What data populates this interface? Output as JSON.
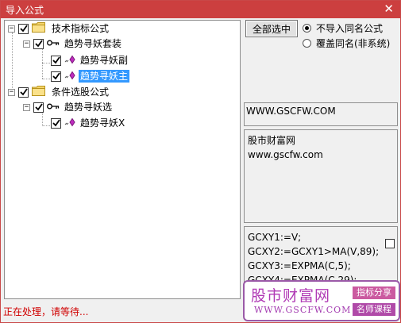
{
  "window": {
    "title": "导入公式",
    "close_glyph": "✕"
  },
  "tree": {
    "nodes": [
      {
        "label": "技术指标公式",
        "expander": "−",
        "icon": "folder-icon"
      },
      {
        "label": "趋势寻妖套装",
        "expander": "−",
        "icon": "key-icon"
      },
      {
        "label": "趋势寻妖副",
        "icon": "formula-icon"
      },
      {
        "label": "趋势寻妖主",
        "icon": "formula-icon",
        "selected": true
      },
      {
        "label": "条件选股公式",
        "expander": "−",
        "icon": "folder-icon"
      },
      {
        "label": "趋势寻妖选",
        "expander": "−",
        "icon": "key-icon"
      },
      {
        "label": "趋势寻妖X",
        "icon": "formula-icon"
      }
    ]
  },
  "controls": {
    "select_all_label": "全部选中",
    "radio_no_import": "不导入同名公式",
    "radio_overwrite": "覆盖同名(非系统)"
  },
  "info": {
    "url": "WWW.GSCFW.COM",
    "desc_line1": "股市财富网",
    "desc_line2": "www.gscfw.com",
    "code_line1": "GCXY1:=V;",
    "code_line2": "GCXY2:=GCXY1>MA(V,89);",
    "code_line3": "GCXY3:=EXPMA(C,5);",
    "code_line4": "GCXY4:=EXPMA(C,29);"
  },
  "status": "正在处理，请等待...",
  "watermark": {
    "brand": "股市财富网",
    "website": "WWW.GSCFW.COM",
    "tag1": "指标分享",
    "tag2": "名师课程",
    "color": "#b03ab5"
  }
}
